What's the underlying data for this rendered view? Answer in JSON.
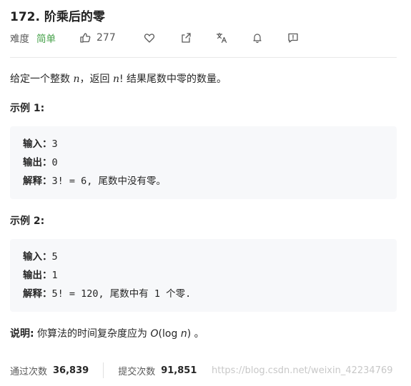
{
  "problem": {
    "title": "172. 阶乘后的零",
    "difficulty_label": "难度",
    "difficulty": "简单",
    "likes": "277",
    "description_pre": "给定一个整数 ",
    "description_var": "n",
    "description_mid": "，返回 ",
    "description_var2": "n",
    "description_post": "! 结果尾数中零的数量。",
    "examples": [
      {
        "heading": "示例 1:",
        "input_label": "输入：",
        "input": "3",
        "output_label": "输出：",
        "output": "0",
        "explain_label": "解释：",
        "explain": "3! = 6, 尾数中没有零。"
      },
      {
        "heading": "示例 2:",
        "input_label": "输入：",
        "input": "5",
        "output_label": "输出：",
        "output": "1",
        "explain_label": "解释：",
        "explain": "5! = 120, 尾数中有 1 个零."
      }
    ],
    "note_label": "说明:",
    "note_pre": " 你算法的时间复杂度应为 ",
    "note_o": "O",
    "note_log": "(log ",
    "note_n": "n",
    "note_post": ") 。"
  },
  "stats": {
    "accepted_label": "通过次数",
    "accepted": "36,839",
    "submitted_label": "提交次数",
    "submitted": "91,851"
  },
  "watermark": "https://blog.csdn.net/weixin_42234769",
  "icons": [
    "thumbs-up-icon",
    "heart-icon",
    "share-icon",
    "translate-icon",
    "bell-icon",
    "feedback-icon"
  ],
  "colors": {
    "easy": "#43a047",
    "code_bg": "#f7f8fa"
  }
}
